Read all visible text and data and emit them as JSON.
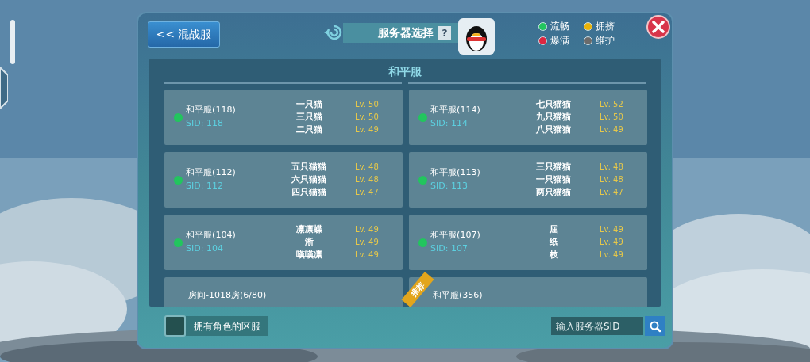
{
  "back_button": {
    "label": "<< 混战服"
  },
  "title": "服务器选择",
  "help_button": {
    "label": "?"
  },
  "legend": [
    {
      "label": "流畅",
      "color": "#22c55e"
    },
    {
      "label": "拥挤",
      "color": "#eab308"
    },
    {
      "label": "爆满",
      "color": "#dc2640"
    },
    {
      "label": "维护",
      "color": "#6b6b6b"
    }
  ],
  "section_title": "和平服",
  "servers": [
    {
      "name": "和平服(118)",
      "sid": "SID: 118",
      "color": "#22c55e",
      "players": [
        {
          "name": "一只猫",
          "level": "Lv. 50"
        },
        {
          "name": "三只猫",
          "level": "Lv. 50"
        },
        {
          "name": "二只猫",
          "level": "Lv. 49"
        }
      ]
    },
    {
      "name": "和平服(114)",
      "sid": "SID: 114",
      "color": "#22c55e",
      "players": [
        {
          "name": "七只猫猫",
          "level": "Lv. 52"
        },
        {
          "name": "九只猫猫",
          "level": "Lv. 50"
        },
        {
          "name": "八只猫猫",
          "level": "Lv. 49"
        }
      ]
    },
    {
      "name": "和平服(112)",
      "sid": "SID: 112",
      "color": "#22c55e",
      "players": [
        {
          "name": "五只猫猫",
          "level": "Lv. 48"
        },
        {
          "name": "六只猫猫",
          "level": "Lv. 48"
        },
        {
          "name": "四只猫猫",
          "level": "Lv. 47"
        }
      ]
    },
    {
      "name": "和平服(113)",
      "sid": "SID: 113",
      "color": "#22c55e",
      "players": [
        {
          "name": "三只猫猫",
          "level": "Lv. 48"
        },
        {
          "name": "一只猫猫",
          "level": "Lv. 48"
        },
        {
          "name": "两只猫猫",
          "level": "Lv. 47"
        }
      ]
    },
    {
      "name": "和平服(104)",
      "sid": "SID: 104",
      "color": "#22c55e",
      "players": [
        {
          "name": "凛凛蝶",
          "level": "Lv. 49"
        },
        {
          "name": "淅",
          "level": "Lv. 49"
        },
        {
          "name": "嘆嘆凛",
          "level": "Lv. 49"
        }
      ]
    },
    {
      "name": "和平服(107)",
      "sid": "SID: 107",
      "color": "#22c55e",
      "players": [
        {
          "name": "屈",
          "level": "Lv. 49"
        },
        {
          "name": "纸",
          "level": "Lv. 49"
        },
        {
          "name": "枝",
          "level": "Lv. 49"
        }
      ]
    },
    {
      "name": "房间-1018房(6/80)"
    },
    {
      "name": "和平服(356)",
      "badge": "推荐"
    }
  ],
  "owned_filter": {
    "label": "拥有角色的区服",
    "checked": false
  },
  "sid_search": {
    "placeholder": "输入服务器SID"
  }
}
